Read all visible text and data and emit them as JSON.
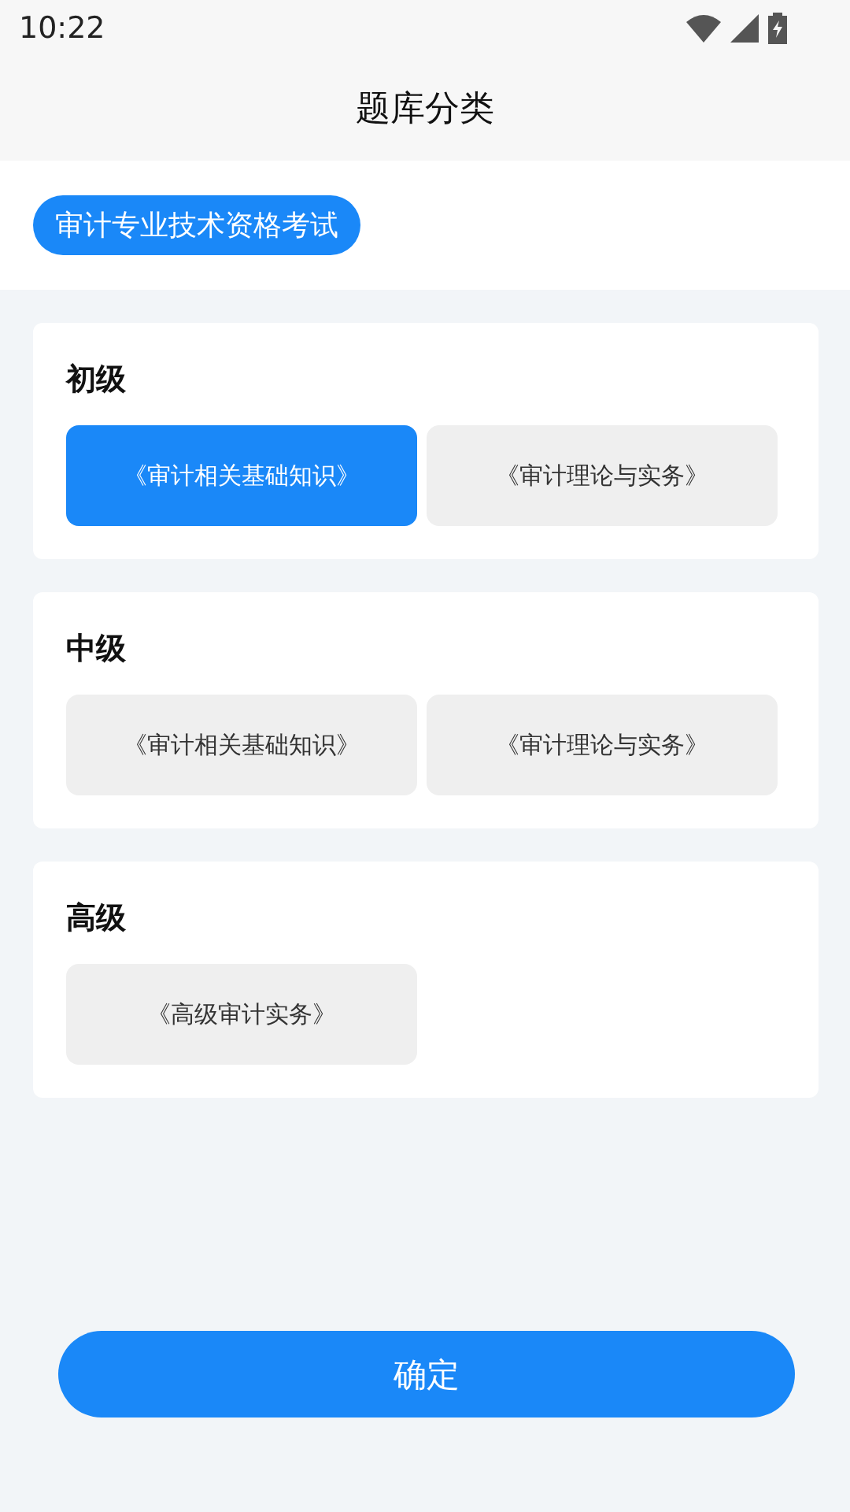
{
  "status_bar": {
    "time": "10:22"
  },
  "title": "题库分类",
  "category_tabs": [
    {
      "label": "审计专业技术资格考试",
      "selected": true
    }
  ],
  "levels": [
    {
      "title": "初级",
      "options": [
        {
          "label": "《审计相关基础知识》",
          "selected": true
        },
        {
          "label": "《审计理论与实务》",
          "selected": false
        }
      ]
    },
    {
      "title": "中级",
      "options": [
        {
          "label": "《审计相关基础知识》",
          "selected": false
        },
        {
          "label": "《审计理论与实务》",
          "selected": false
        }
      ]
    },
    {
      "title": "高级",
      "options": [
        {
          "label": "《高级审计实务》",
          "selected": false
        }
      ]
    }
  ],
  "confirm_button": "确定"
}
